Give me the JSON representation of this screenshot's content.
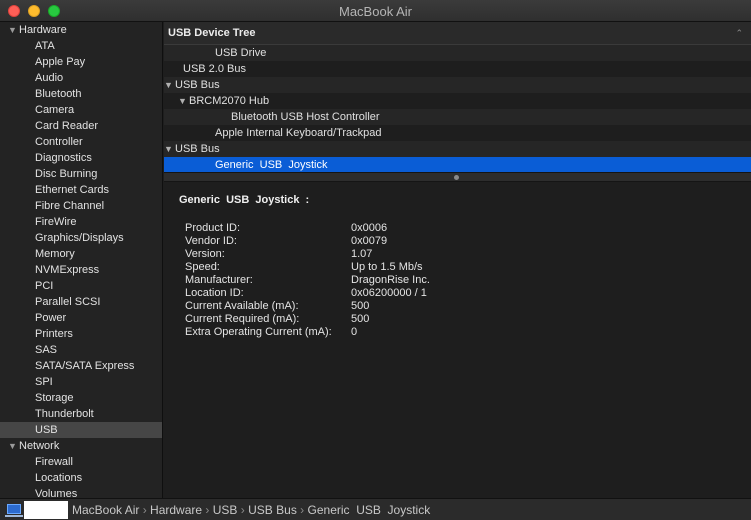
{
  "window": {
    "title": "MacBook Air"
  },
  "sidebar": {
    "rows": [
      {
        "type": "cat",
        "label": "Hardware",
        "expanded": true
      },
      {
        "type": "item",
        "label": "ATA"
      },
      {
        "type": "item",
        "label": "Apple Pay"
      },
      {
        "type": "item",
        "label": "Audio"
      },
      {
        "type": "item",
        "label": "Bluetooth"
      },
      {
        "type": "item",
        "label": "Camera"
      },
      {
        "type": "item",
        "label": "Card Reader"
      },
      {
        "type": "item",
        "label": "Controller"
      },
      {
        "type": "item",
        "label": "Diagnostics"
      },
      {
        "type": "item",
        "label": "Disc Burning"
      },
      {
        "type": "item",
        "label": "Ethernet Cards"
      },
      {
        "type": "item",
        "label": "Fibre Channel"
      },
      {
        "type": "item",
        "label": "FireWire"
      },
      {
        "type": "item",
        "label": "Graphics/Displays"
      },
      {
        "type": "item",
        "label": "Memory"
      },
      {
        "type": "item",
        "label": "NVMExpress"
      },
      {
        "type": "item",
        "label": "PCI"
      },
      {
        "type": "item",
        "label": "Parallel SCSI"
      },
      {
        "type": "item",
        "label": "Power"
      },
      {
        "type": "item",
        "label": "Printers"
      },
      {
        "type": "item",
        "label": "SAS"
      },
      {
        "type": "item",
        "label": "SATA/SATA Express"
      },
      {
        "type": "item",
        "label": "SPI"
      },
      {
        "type": "item",
        "label": "Storage"
      },
      {
        "type": "item",
        "label": "Thunderbolt"
      },
      {
        "type": "item",
        "label": "USB",
        "selected": true
      },
      {
        "type": "cat",
        "label": "Network",
        "expanded": true
      },
      {
        "type": "item",
        "label": "Firewall"
      },
      {
        "type": "item",
        "label": "Locations"
      },
      {
        "type": "item",
        "label": "Volumes"
      }
    ]
  },
  "tree": {
    "header": "USB Device Tree",
    "rows": [
      {
        "label": "USB Drive",
        "level": 2,
        "arrow": false
      },
      {
        "label": "USB 2.0 Bus",
        "level": 0,
        "arrow": false
      },
      {
        "label": "USB Bus",
        "level": 0,
        "arrow": true
      },
      {
        "label": "BRCM2070 Hub",
        "level": 1,
        "arrow": true
      },
      {
        "label": "Bluetooth USB Host Controller",
        "level": 3,
        "arrow": false
      },
      {
        "label": "Apple Internal Keyboard/Trackpad",
        "level": 2,
        "arrow": false
      },
      {
        "label": "USB Bus",
        "level": 0,
        "arrow": true
      },
      {
        "label": "Generic  USB  Joystick",
        "level": 2,
        "arrow": false,
        "selected": true
      }
    ]
  },
  "detail": {
    "title": "Generic  USB  Joystick  :",
    "properties": [
      {
        "label": "Product ID:",
        "value": "0x0006"
      },
      {
        "label": "Vendor ID:",
        "value": "0x0079"
      },
      {
        "label": "Version:",
        "value": "1.07"
      },
      {
        "label": "Speed:",
        "value": "Up to 1.5 Mb/s"
      },
      {
        "label": "Manufacturer:",
        "value": "DragonRise Inc."
      },
      {
        "label": "Location ID:",
        "value": "0x06200000 / 1"
      },
      {
        "label": "Current Available (mA):",
        "value": "500"
      },
      {
        "label": "Current Required (mA):",
        "value": "500"
      },
      {
        "label": "Extra Operating Current (mA):",
        "value": "0"
      }
    ]
  },
  "pathbar": {
    "items": [
      "MacBook Air",
      "Hardware",
      "USB",
      "USB Bus",
      "Generic  USB  Joystick"
    ],
    "separator": "›"
  },
  "colors": {
    "selection": "#0a5dd6",
    "sidebar_selection": "#464646"
  }
}
